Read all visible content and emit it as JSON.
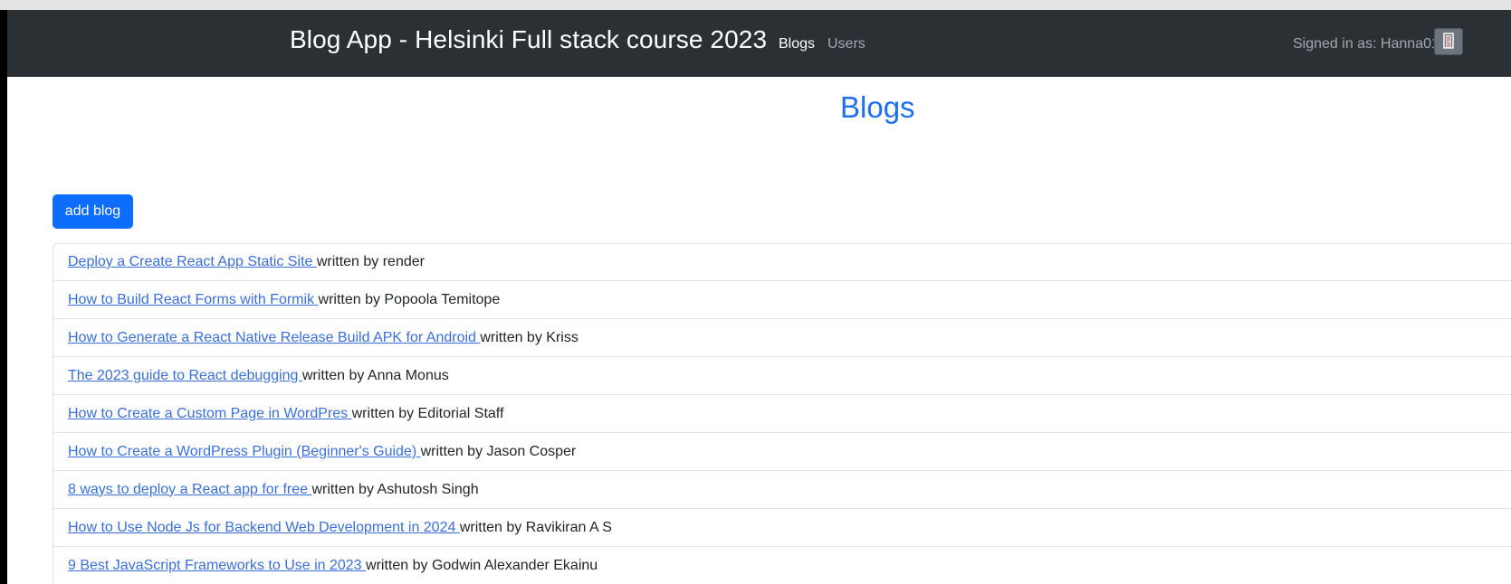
{
  "navbar": {
    "brand": "Blog App - Helsinki Full stack course 2023",
    "links": [
      "Blogs",
      "Users"
    ],
    "signed_in": "Signed in as: Hanna01",
    "logout_icon": "door-exit-icon"
  },
  "main": {
    "title": "Blogs",
    "add_button": "add blog"
  },
  "blogs": [
    {
      "title": "Deploy a Create React App Static Site ",
      "author": "written by render"
    },
    {
      "title": "How to Build React Forms with Formik ",
      "author": "written by Popoola Temitope"
    },
    {
      "title": "How to Generate a React Native Release Build APK for Android ",
      "author": "written by Kriss"
    },
    {
      "title": "The 2023 guide to React debugging ",
      "author": "written by Anna Monus"
    },
    {
      "title": "How to Create a Custom Page in WordPres ",
      "author": "written by Editorial Staff"
    },
    {
      "title": "How to Create a WordPress Plugin (Beginner's Guide) ",
      "author": "written by Jason Cosper"
    },
    {
      "title": "8 ways to deploy a React app for free ",
      "author": "written by Ashutosh Singh"
    },
    {
      "title": "How to Use Node Js for Backend Web Development in 2024 ",
      "author": "written by Ravikiran A S"
    },
    {
      "title": "9 Best JavaScript Frameworks to Use in 2023 ",
      "author": "written by Godwin Alexander Ekainu"
    }
  ]
}
